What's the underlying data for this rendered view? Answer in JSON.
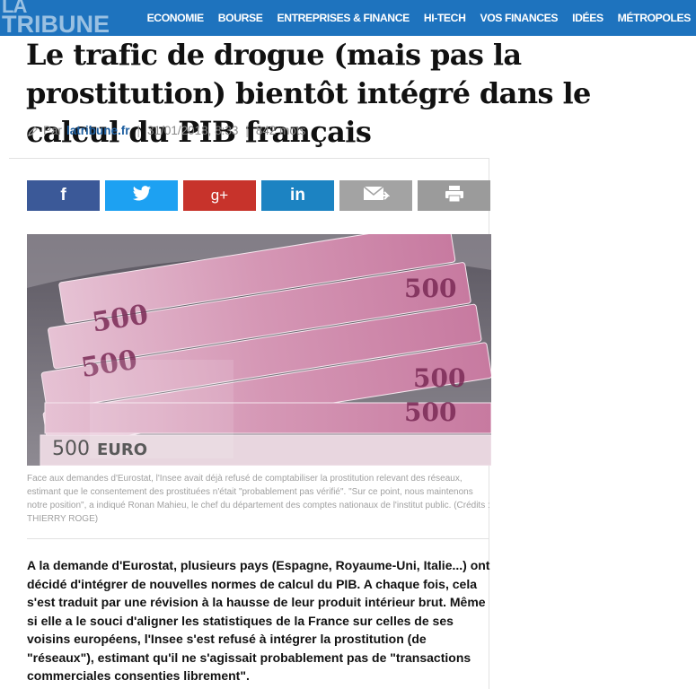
{
  "site": {
    "logo_line1": "LA",
    "logo_line2": "TRIBUNE"
  },
  "nav": {
    "items": [
      "ECONOMIE",
      "BOURSE",
      "ENTREPRISES & FINANCE",
      "HI-TECH",
      "VOS FINANCES",
      "IDÉES",
      "MÉTROPOLES"
    ]
  },
  "article": {
    "title": "Le trafic de drogue (mais pas la prostitution) bientôt intégré dans le calcul du PIB français",
    "meta": {
      "by": "Par",
      "author": "latribune.fr",
      "date": "31/01/2018, 8:33",
      "words": "842  mots"
    },
    "share": {
      "facebook": "f",
      "googleplus": "g+",
      "linkedin": "in"
    },
    "image": {
      "banknote_value": "500",
      "banknote_text": "EURO"
    },
    "caption": "Face aux demandes d'Eurostat, l'Insee avait déjà refusé de comptabiliser la prostitution relevant des réseaux, estimant que le consentement des prostituées n'était \"probablement pas vérifié\". \"Sur ce point, nous maintenons notre position\", a indiqué Ronan Mahieu, le chef du département des comptes nationaux de l'institut public. (Crédits : THIERRY ROGE)",
    "lead": "A la demande d'Eurostat, plusieurs pays (Espagne, Royaume-Uni, Italie...) ont décidé d'intégrer de nouvelles normes de calcul du PIB. A chaque fois, cela s'est traduit par une révision à la hausse de leur produit intérieur brut. Même si elle a le souci d'aligner les statistiques de la France sur celles de ses voisins européens, l'Insee s'est refusé à intégrer la prostitution (de \"réseaux\"), estimant qu'il ne s'agissait probablement pas de \"transactions commerciales consenties librement\"."
  },
  "colors": {
    "brand_blue": "#1e73be",
    "facebook": "#3b5998",
    "twitter": "#1da1f2",
    "googleplus": "#c7332b",
    "linkedin": "#1c83c2",
    "mail": "#a3a3a3",
    "print": "#9b9b9b",
    "author_link": "#1e5fa0",
    "banknote_pink": "#c77aa0"
  },
  "icons": {
    "pencil": "pencil-icon",
    "twitter": "twitter-bird-icon",
    "mail": "envelope-icon",
    "print": "printer-icon"
  }
}
